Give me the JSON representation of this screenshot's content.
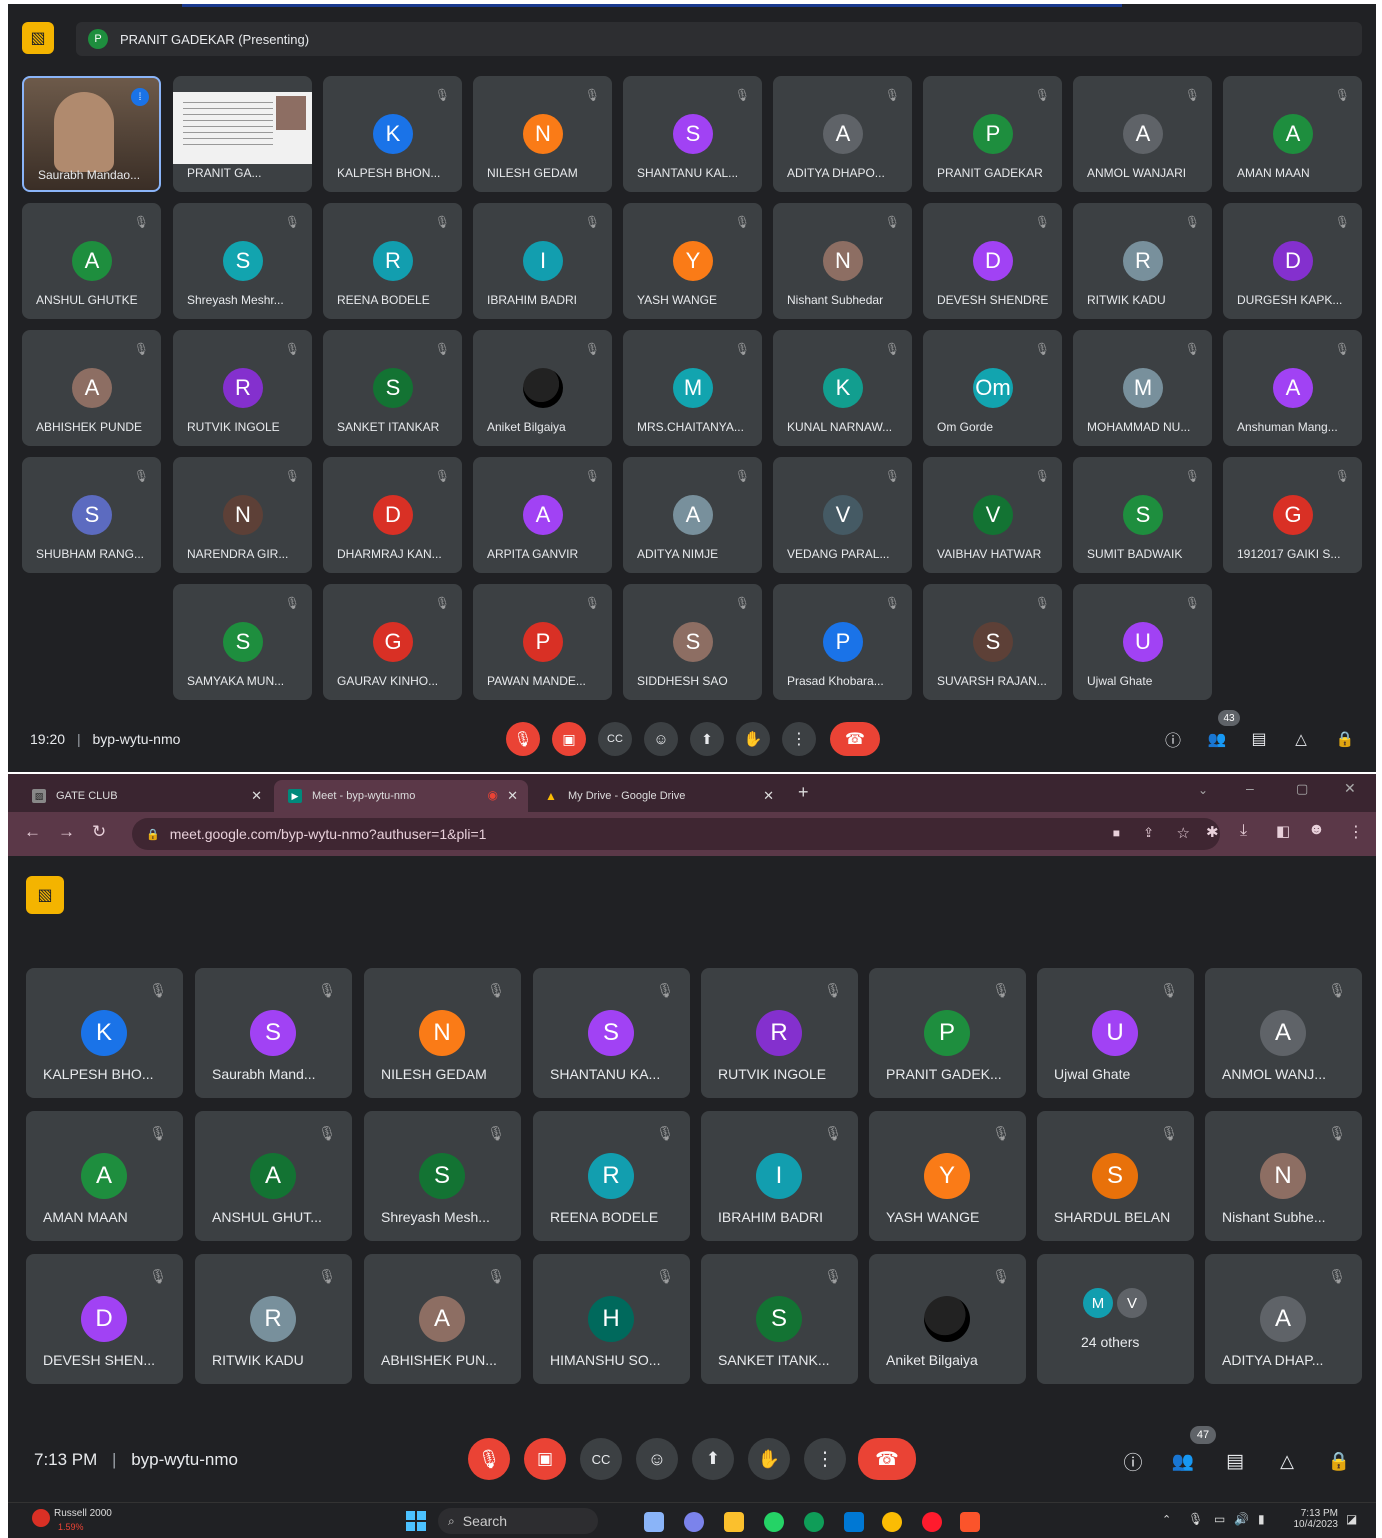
{
  "meeting1": {
    "presenting_label": "PRANIT GADEKAR (Presenting)",
    "presenter_initial": "P",
    "time": "19:20",
    "code": "byp-wytu-nmo",
    "people_count": "43",
    "tiles": [
      {
        "kind": "video",
        "name": "Saurabh Mandao..."
      },
      {
        "kind": "screen",
        "name": "PRANIT GA..."
      },
      {
        "initial": "K",
        "name": "KALPESH BHON...",
        "color": "#1a73e8"
      },
      {
        "initial": "N",
        "name": "NILESH GEDAM",
        "color": "#fa7b17"
      },
      {
        "initial": "S",
        "name": "SHANTANU KAL...",
        "color": "#a142f4"
      },
      {
        "initial": "A",
        "name": "ADITYA DHAPO...",
        "color": "#5f6368"
      },
      {
        "initial": "P",
        "name": "PRANIT GADEKAR",
        "color": "#1e8e3e"
      },
      {
        "initial": "A",
        "name": "ANMOL WANJARI",
        "color": "#5f6368"
      },
      {
        "initial": "A",
        "name": "AMAN MAAN",
        "color": "#1e8e3e"
      },
      {
        "initial": "A",
        "name": "ANSHUL GHUTKE",
        "color": "#1e8e3e"
      },
      {
        "initial": "S",
        "name": "Shreyash Meshr...",
        "color": "#12a4af"
      },
      {
        "initial": "R",
        "name": "REENA BODELE",
        "color": "#129eaf"
      },
      {
        "initial": "I",
        "name": "IBRAHIM BADRI",
        "color": "#129eaf"
      },
      {
        "initial": "Y",
        "name": "YASH WANGE",
        "color": "#fa7b17"
      },
      {
        "initial": "N",
        "name": "Nishant Subhedar",
        "color": "#8d6e63"
      },
      {
        "initial": "D",
        "name": "DEVESH SHENDRE",
        "color": "#a142f4"
      },
      {
        "initial": "R",
        "name": "RITWIK KADU",
        "color": "#78909c"
      },
      {
        "initial": "D",
        "name": "DURGESH KAPK...",
        "color": "#8430ce"
      },
      {
        "initial": "A",
        "name": "ABHISHEK PUNDE",
        "color": "#8d6e63"
      },
      {
        "initial": "R",
        "name": "RUTVIK INGOLE",
        "color": "#8430ce"
      },
      {
        "initial": "S",
        "name": "SANKET ITANKAR",
        "color": "#137333"
      },
      {
        "kind": "photo",
        "initial": "",
        "name": "Aniket Bilgaiya",
        "color": "#000000"
      },
      {
        "initial": "M",
        "name": "MRS.CHAITANYA...",
        "color": "#12a4af"
      },
      {
        "initial": "K",
        "name": "KUNAL NARNAW...",
        "color": "#129e8f"
      },
      {
        "initial": "Om",
        "name": "Om Gorde",
        "color": "#12a4af"
      },
      {
        "initial": "M",
        "name": "MOHAMMAD NU...",
        "color": "#78909c"
      },
      {
        "initial": "A",
        "name": "Anshuman Mang...",
        "color": "#a142f4"
      },
      {
        "initial": "S",
        "name": "SHUBHAM RANG...",
        "color": "#5c6bc0"
      },
      {
        "initial": "N",
        "name": "NARENDRA GIR...",
        "color": "#5d4037"
      },
      {
        "initial": "D",
        "name": "DHARMRAJ KAN...",
        "color": "#d93025"
      },
      {
        "initial": "A",
        "name": "ARPITA GANVIR",
        "color": "#a142f4"
      },
      {
        "initial": "A",
        "name": "ADITYA NIMJE",
        "color": "#78909c"
      },
      {
        "initial": "V",
        "name": "VEDANG PARAL...",
        "color": "#455a64"
      },
      {
        "initial": "V",
        "name": "VAIBHAV HATWAR",
        "color": "#137333"
      },
      {
        "initial": "S",
        "name": "SUMIT BADWAIK",
        "color": "#1e8e3e"
      },
      {
        "initial": "G",
        "name": "1912017 GAIKI S...",
        "color": "#d93025"
      },
      {
        "initial": "S",
        "name": "SAMYAKA MUN...",
        "color": "#1e8e3e"
      },
      {
        "initial": "G",
        "name": "GAURAV KINHO...",
        "color": "#d93025"
      },
      {
        "initial": "P",
        "name": "PAWAN MANDE...",
        "color": "#d93025"
      },
      {
        "initial": "S",
        "name": "SIDDHESH SAO",
        "color": "#8d6e63"
      },
      {
        "initial": "P",
        "name": "Prasad Khobara...",
        "color": "#1a73e8"
      },
      {
        "initial": "S",
        "name": "SUVARSH RAJAN...",
        "color": "#5d4037"
      },
      {
        "initial": "U",
        "name": "Ujwal Ghate",
        "color": "#a142f4"
      }
    ]
  },
  "browser": {
    "tabs": [
      {
        "label": "GATE CLUB",
        "icon": "image-icon",
        "active": false
      },
      {
        "label": "Meet - byp-wytu-nmo",
        "icon": "meet-icon",
        "active": true
      },
      {
        "label": "My Drive - Google Drive",
        "icon": "drive-icon",
        "active": false
      }
    ],
    "url": "meet.google.com/byp-wytu-nmo?authuser=1&pli=1"
  },
  "meeting2": {
    "time": "7:13 PM",
    "code": "byp-wytu-nmo",
    "people_count": "47",
    "others_label": "24 others",
    "others_initials": [
      "M",
      "V"
    ],
    "tiles": [
      {
        "initial": "K",
        "name": "KALPESH BHO...",
        "color": "#1a73e8"
      },
      {
        "initial": "S",
        "name": "Saurabh Mand...",
        "color": "#a142f4"
      },
      {
        "initial": "N",
        "name": "NILESH GEDAM",
        "color": "#fa7b17"
      },
      {
        "initial": "S",
        "name": "SHANTANU KA...",
        "color": "#a142f4"
      },
      {
        "initial": "R",
        "name": "RUTVIK INGOLE",
        "color": "#8430ce"
      },
      {
        "initial": "P",
        "name": "PRANIT GADEK...",
        "color": "#1e8e3e"
      },
      {
        "initial": "U",
        "name": "Ujwal Ghate",
        "color": "#a142f4"
      },
      {
        "initial": "A",
        "name": "ANMOL WANJ...",
        "color": "#5f6368"
      },
      {
        "initial": "A",
        "name": "AMAN MAAN",
        "color": "#1e8e3e"
      },
      {
        "initial": "A",
        "name": "ANSHUL GHUT...",
        "color": "#137333"
      },
      {
        "initial": "S",
        "name": "Shreyash Mesh...",
        "color": "#137333"
      },
      {
        "initial": "R",
        "name": "REENA BODELE",
        "color": "#129eaf"
      },
      {
        "initial": "I",
        "name": "IBRAHIM BADRI",
        "color": "#129eaf"
      },
      {
        "initial": "Y",
        "name": "YASH WANGE",
        "color": "#fa7b17"
      },
      {
        "initial": "S",
        "name": "SHARDUL BELAN",
        "color": "#e8710a"
      },
      {
        "initial": "N",
        "name": "Nishant Subhe...",
        "color": "#8d6e63"
      },
      {
        "initial": "D",
        "name": "DEVESH SHEN...",
        "color": "#a142f4"
      },
      {
        "initial": "R",
        "name": "RITWIK KADU",
        "color": "#78909c"
      },
      {
        "initial": "A",
        "name": "ABHISHEK PUN...",
        "color": "#8d6e63"
      },
      {
        "initial": "H",
        "name": "HIMANSHU SO...",
        "color": "#00695c"
      },
      {
        "initial": "S",
        "name": "SANKET ITANK...",
        "color": "#137333"
      },
      {
        "kind": "photo",
        "initial": "",
        "name": "Aniket Bilgaiya",
        "color": "#000000"
      },
      {
        "kind": "others"
      },
      {
        "initial": "A",
        "name": "ADITYA DHAP...",
        "color": "#5f6368"
      }
    ]
  },
  "taskbar": {
    "weather_title": "Russell 2000",
    "weather_value": "1.59%",
    "search_label": "Search",
    "clock_time": "7:13 PM",
    "clock_date": "10/4/2023"
  }
}
